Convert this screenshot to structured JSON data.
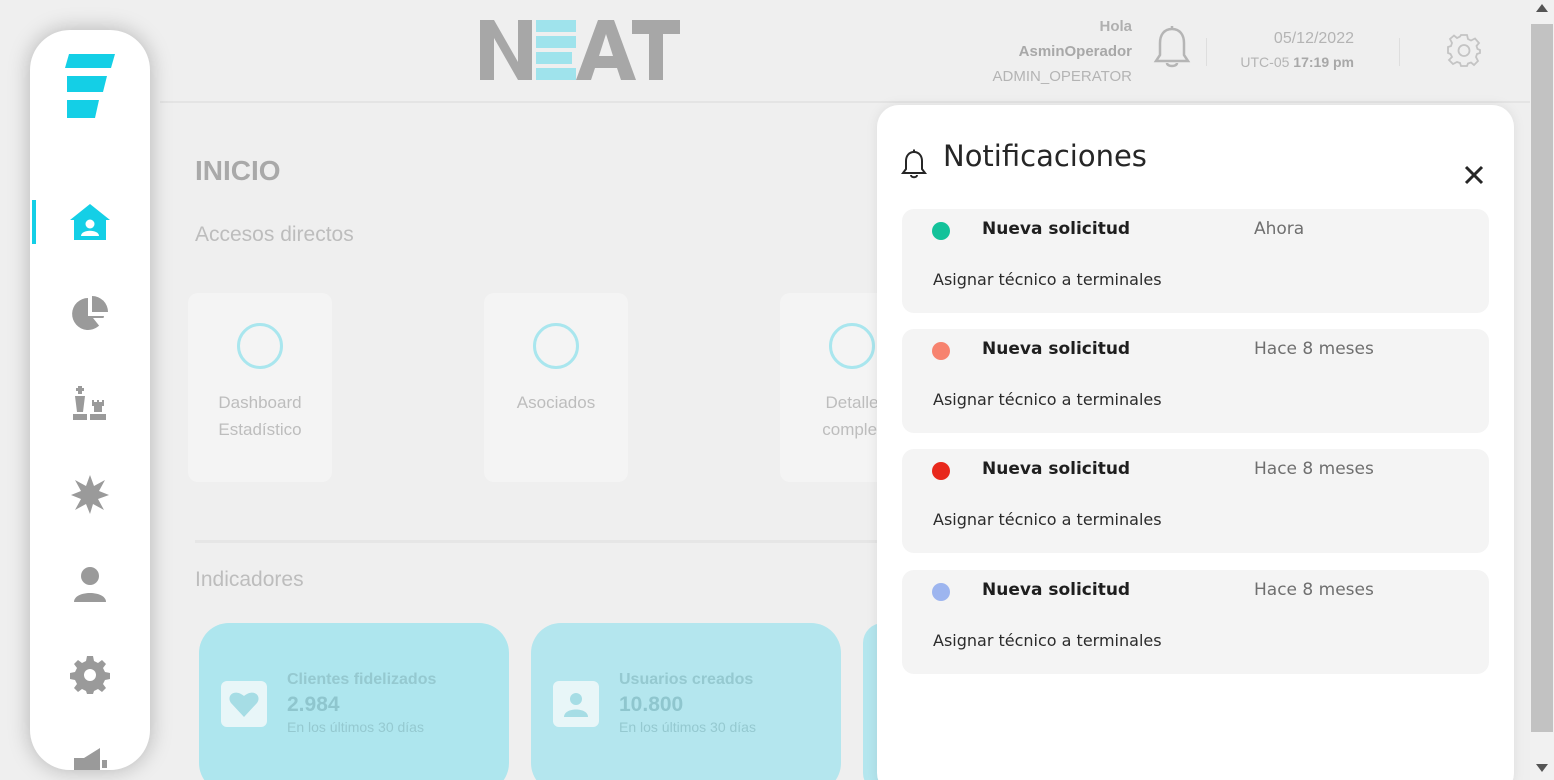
{
  "header": {
    "brand": "NEAT",
    "greeting": "Hola",
    "user_name": "AsminOperador",
    "user_role": "ADMIN_OPERATOR",
    "date": "05/12/2022",
    "timezone": "UTC-05",
    "time": "17:19 pm"
  },
  "sidebar": {
    "active_item": "home",
    "items": [
      {
        "icon": "home-user-icon"
      },
      {
        "icon": "pie-chart-icon"
      },
      {
        "icon": "chess-pieces-icon"
      },
      {
        "icon": "starburst-icon"
      },
      {
        "icon": "person-icon"
      },
      {
        "icon": "gear-icon"
      },
      {
        "icon": "megaphone-icon"
      }
    ]
  },
  "main": {
    "title": "INICIO",
    "shortcuts_label": "Accesos directos",
    "shortcuts": [
      {
        "line1": "Dashboard",
        "line2": "Estadístico"
      },
      {
        "line1": "Asociados",
        "line2": ""
      },
      {
        "line1": "Detalle",
        "line2": "complet"
      }
    ],
    "indicators_label": "Indicadores",
    "indicators": [
      {
        "title": "Clientes fidelizados",
        "value": "2.984",
        "subtitle": "En los últimos 30 días",
        "icon": "heart-icon"
      },
      {
        "title": "Usuarios creados",
        "value": "10.800",
        "subtitle": "En los últimos 30 días",
        "icon": "user-card-icon"
      }
    ]
  },
  "notifications": {
    "title": "Notificaciones",
    "items": [
      {
        "title": "Nueva solicitud",
        "time": "Ahora",
        "description": "Asignar técnico a terminales",
        "color": "#13c29a"
      },
      {
        "title": "Nueva solicitud",
        "time": "Hace 8 meses",
        "description": "Asignar técnico a terminales",
        "color": "#f7836f"
      },
      {
        "title": "Nueva solicitud",
        "time": "Hace 8 meses",
        "description": "Asignar técnico a terminales",
        "color": "#e8281c"
      },
      {
        "title": "Nueva solicitud",
        "time": "Hace 8 meses",
        "description": "Asignar técnico a terminales",
        "color": "#9db5ef"
      }
    ]
  },
  "colors": {
    "accent": "#14cfe6",
    "indicator_bg": "#aee6ee"
  }
}
